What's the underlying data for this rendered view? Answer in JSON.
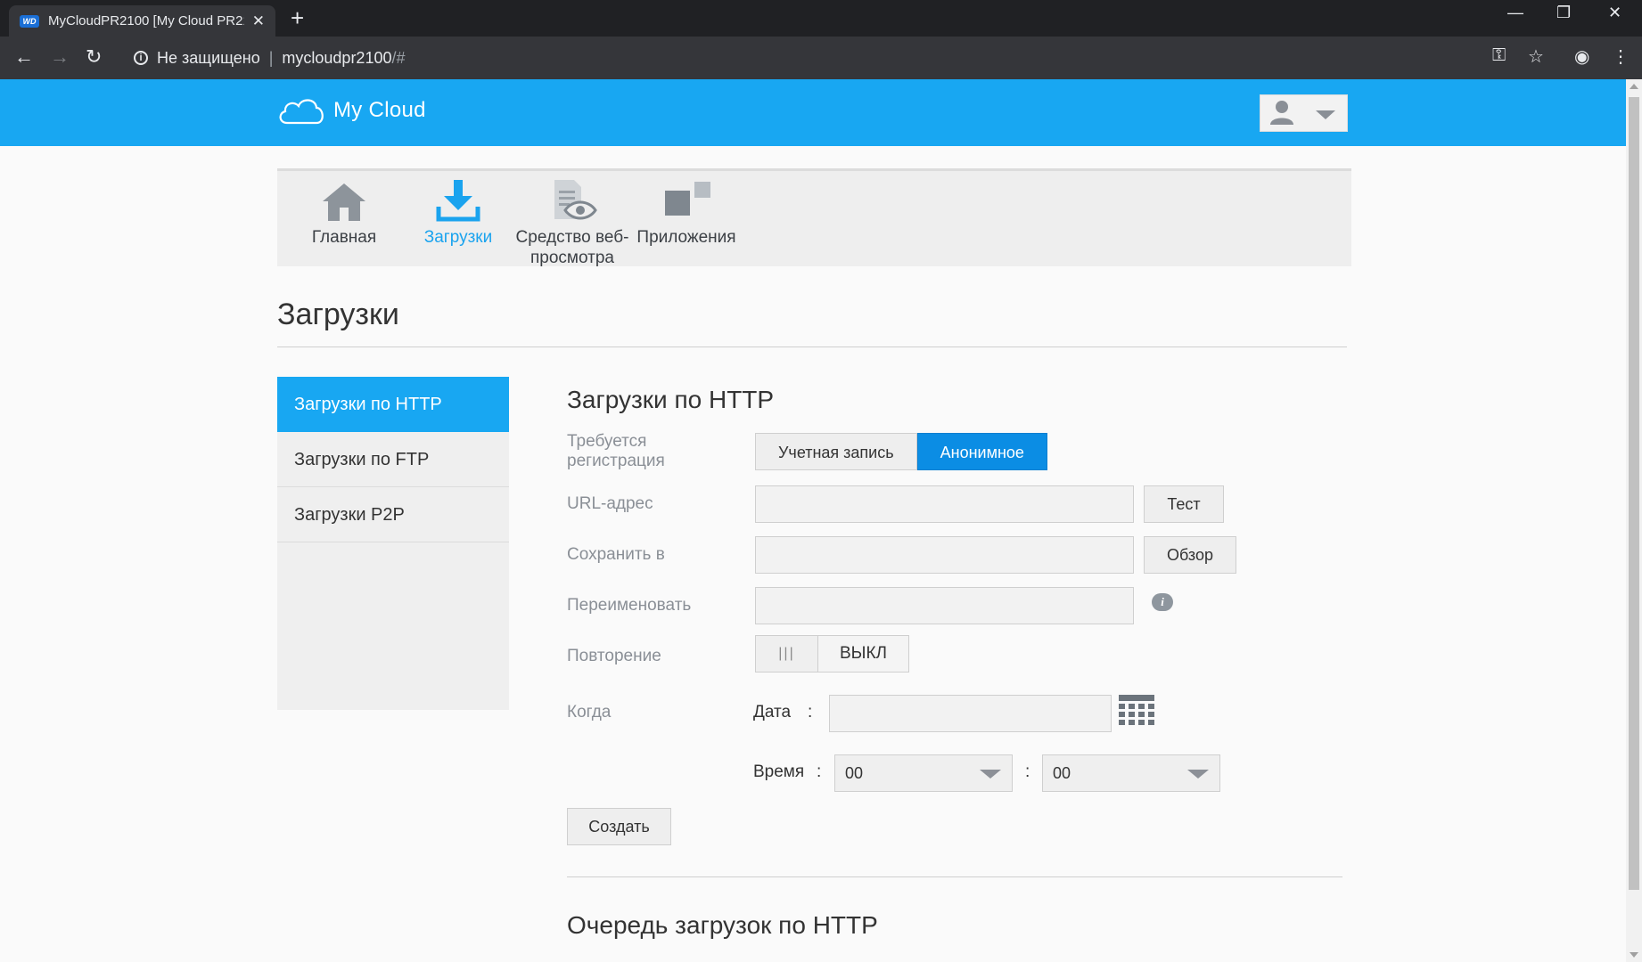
{
  "browser": {
    "tab_title": "MyCloudPR2100 [My Cloud PR2100]",
    "tab_close": "✕",
    "new_tab": "+",
    "security_label": "Не защищено",
    "url_host": "mycloudpr2100",
    "url_path": "/#"
  },
  "header": {
    "logo_text": "My Cloud",
    "brand_color": "#18a7f2"
  },
  "nav": {
    "items": [
      {
        "label": "Главная",
        "icon": "home-icon"
      },
      {
        "label": "Загрузки",
        "icon": "download-icon",
        "active": true
      },
      {
        "label": "Средство веб-просмотра",
        "icon": "web-viewer-icon"
      },
      {
        "label": "Приложения",
        "icon": "apps-icon"
      }
    ]
  },
  "page": {
    "title": "Загрузки"
  },
  "sidebar": {
    "items": [
      {
        "label": "Загрузки по HTTP",
        "active": true
      },
      {
        "label": "Загрузки по FTP"
      },
      {
        "label": "Загрузки P2P"
      }
    ]
  },
  "form": {
    "section_title": "Загрузки по HTTP",
    "login_label": "Требуется регистрация",
    "login_options": [
      "Учетная запись",
      "Анонимное"
    ],
    "login_selected": "Анонимное",
    "url_label": "URL-адрес",
    "url_value": "",
    "test_button": "Тест",
    "save_to_label": "Сохранить в",
    "save_to_value": "",
    "browse_button": "Обзор",
    "rename_label": "Переименовать",
    "rename_value": "",
    "repeat_label": "Повторение",
    "repeat_state": "ВЫКЛ",
    "when_label": "Когда",
    "date_label": "Дата",
    "date_value": "",
    "time_label": "Время",
    "colon": ":",
    "hour_value": "00",
    "minute_value": "00",
    "create_button": "Создать"
  },
  "queue": {
    "title": "Очередь загрузок по HTTP"
  }
}
